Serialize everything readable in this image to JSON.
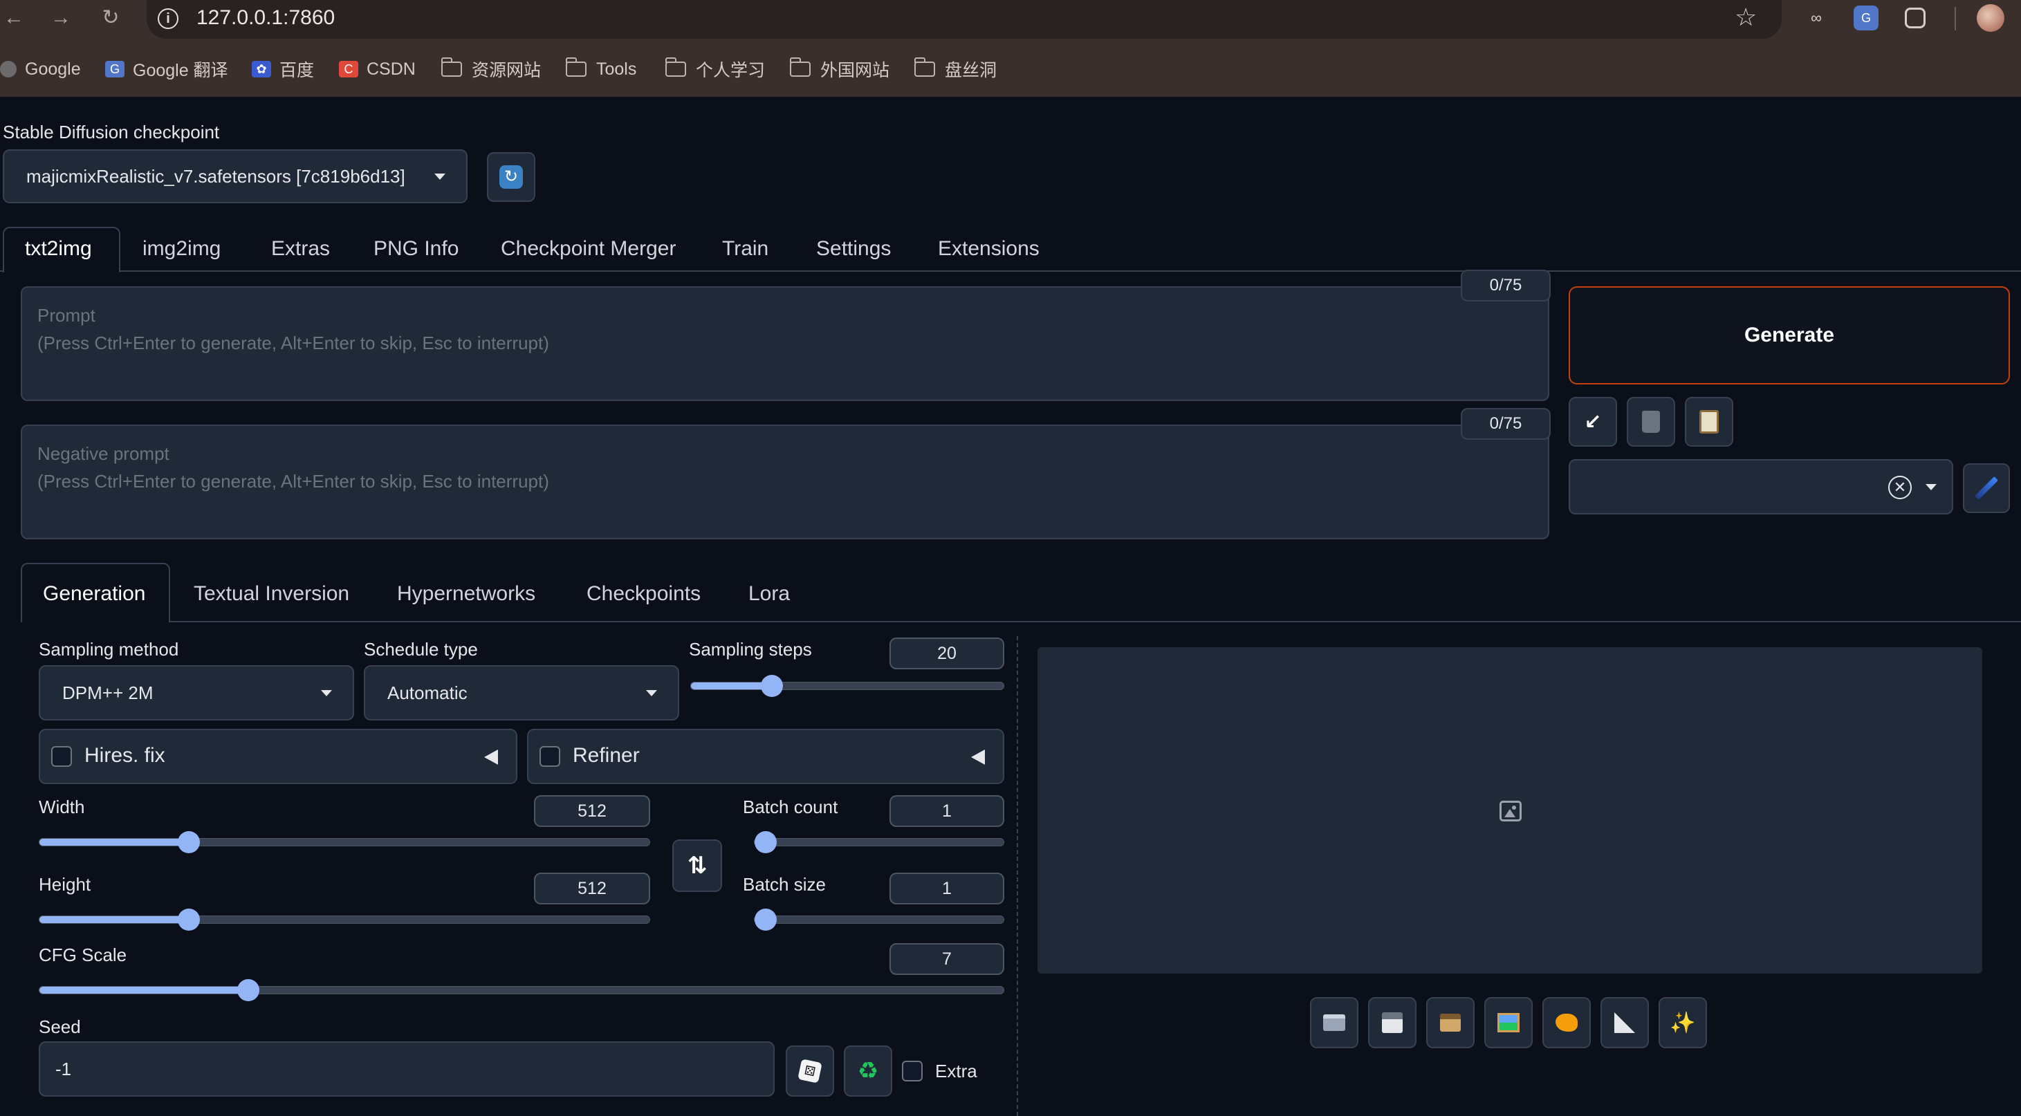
{
  "browser": {
    "url": "127.0.0.1:7860",
    "bookmarks": [
      {
        "label": "Google"
      },
      {
        "label": "Google 翻译"
      },
      {
        "label": "百度"
      },
      {
        "label": "CSDN"
      },
      {
        "label": "资源网站"
      },
      {
        "label": "Tools"
      },
      {
        "label": "个人学习"
      },
      {
        "label": "外国网站"
      },
      {
        "label": "盘丝洞"
      }
    ]
  },
  "checkpoint": {
    "label": "Stable Diffusion checkpoint",
    "value": "majicmixRealistic_v7.safetensors [7c819b6d13]"
  },
  "tabs": [
    "txt2img",
    "img2img",
    "Extras",
    "PNG Info",
    "Checkpoint Merger",
    "Train",
    "Settings",
    "Extensions"
  ],
  "prompt": {
    "placeholder": "Prompt\n(Press Ctrl+Enter to generate, Alt+Enter to skip, Esc to interrupt)",
    "counter": "0/75"
  },
  "negative_prompt": {
    "placeholder": "Negative prompt\n(Press Ctrl+Enter to generate, Alt+Enter to skip, Esc to interrupt)",
    "counter": "0/75"
  },
  "generate_label": "Generate",
  "subtabs": [
    "Generation",
    "Textual Inversion",
    "Hypernetworks",
    "Checkpoints",
    "Lora"
  ],
  "sampling_method": {
    "label": "Sampling method",
    "value": "DPM++ 2M"
  },
  "schedule_type": {
    "label": "Schedule type",
    "value": "Automatic"
  },
  "sampling_steps": {
    "label": "Sampling steps",
    "value": "20",
    "fraction": 0.24
  },
  "hires_fix": {
    "label": "Hires. fix",
    "checked": false
  },
  "refiner": {
    "label": "Refiner",
    "checked": false
  },
  "width": {
    "label": "Width",
    "value": "512",
    "fraction": 0.235
  },
  "height": {
    "label": "Height",
    "value": "512",
    "fraction": 0.235
  },
  "batch_count": {
    "label": "Batch count",
    "value": "1",
    "fraction": 0.0
  },
  "batch_size": {
    "label": "Batch size",
    "value": "1",
    "fraction": 0.0
  },
  "cfg_scale": {
    "label": "CFG Scale",
    "value": "7",
    "fraction": 0.21
  },
  "seed": {
    "label": "Seed",
    "value": "-1"
  },
  "extra": {
    "label": "Extra",
    "checked": false
  },
  "colors": {
    "accent": "#93b4f5",
    "generate_border": "#c2410c",
    "background": "#0b0f19"
  }
}
